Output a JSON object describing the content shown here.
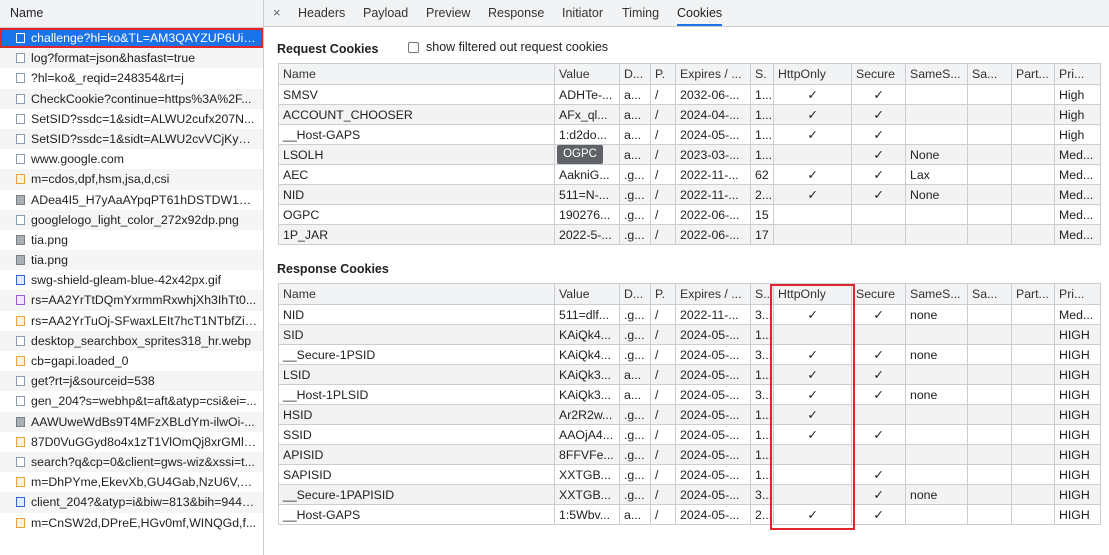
{
  "left_panel": {
    "header": "Name",
    "requests": [
      {
        "name": "challenge?hl=ko&TL=AM3QAYZUP6Ui4...",
        "icon": "document-icon",
        "selected": true
      },
      {
        "name": "log?format=json&hasfast=true",
        "icon": "document-icon"
      },
      {
        "name": "?hl=ko&_reqid=248354&rt=j",
        "icon": "document-icon"
      },
      {
        "name": "CheckCookie?continue=https%3A%2F...",
        "icon": "document-icon"
      },
      {
        "name": "SetSID?ssdc=1&sidt=ALWU2cufx207N...",
        "icon": "document-icon"
      },
      {
        "name": "SetSID?ssdc=1&sidt=ALWU2cvVCjKym...",
        "icon": "document-icon"
      },
      {
        "name": "www.google.com",
        "icon": "document-icon"
      },
      {
        "name": "m=cdos,dpf,hsm,jsa,d,csi",
        "icon": "script-icon"
      },
      {
        "name": "ADea4I5_H7yAaAYpqPT61hDSTDW1AX...",
        "icon": "avatar-image-icon"
      },
      {
        "name": "googlelogo_light_color_272x92dp.png",
        "icon": "document-icon"
      },
      {
        "name": "tia.png",
        "icon": "image-icon"
      },
      {
        "name": "tia.png",
        "icon": "image-icon"
      },
      {
        "name": "swg-shield-gleam-blue-42x42px.gif",
        "icon": "shield-image-icon"
      },
      {
        "name": "rs=AA2YrTtDQmYxrmmRxwhjXh3IhTt0...",
        "icon": "font-icon"
      },
      {
        "name": "rs=AA2YrTuOj-SFwaxLEIt7hcT1NTbfZiP...",
        "icon": "script-icon"
      },
      {
        "name": "desktop_searchbox_sprites318_hr.webp",
        "icon": "document-icon"
      },
      {
        "name": "cb=gapi.loaded_0",
        "icon": "script-icon"
      },
      {
        "name": "get?rt=j&sourceid=538",
        "icon": "document-icon"
      },
      {
        "name": "gen_204?s=webhp&t=aft&atyp=csi&ei=...",
        "icon": "document-icon"
      },
      {
        "name": "AAWUweWdBs9T4MFzXBLdYm-ilwOi-...",
        "icon": "avatar-image-icon"
      },
      {
        "name": "87D0VuGGyd8o4x1zT1VlOmQj8xrGMl1...",
        "icon": "script-icon"
      },
      {
        "name": "search?q&cp=0&client=gws-wiz&xssi=t...",
        "icon": "document-icon"
      },
      {
        "name": "m=DhPYme,EkevXb,GU4Gab,NzU6V,aa...",
        "icon": "script-icon"
      },
      {
        "name": "client_204?&atyp=i&biw=813&bih=944&...",
        "icon": "download-icon"
      },
      {
        "name": "m=CnSW2d,DPreE,HGv0mf,WINQGd,f...",
        "icon": "script-icon"
      }
    ]
  },
  "tabs": {
    "close": "×",
    "items": [
      "Headers",
      "Payload",
      "Preview",
      "Response",
      "Initiator",
      "Timing",
      "Cookies"
    ],
    "active": "Cookies"
  },
  "request_cookies": {
    "title": "Request Cookies",
    "filter_label": "show filtered out request cookies",
    "columns": [
      "Name",
      "Value",
      "D...",
      "P.",
      "Expires / ...",
      "S.",
      "HttpOnly",
      "Secure",
      "SameS...",
      "Sa...",
      "Part...",
      "Pri..."
    ],
    "rows": [
      [
        "SMSV",
        "ADHTe-...",
        "a...",
        "/",
        "2032-06-...",
        "1...",
        "✓",
        "✓",
        "",
        "",
        "",
        "High"
      ],
      [
        "ACCOUNT_CHOOSER",
        "AFx_ql...",
        "a...",
        "/",
        "2024-04-...",
        "1...",
        "✓",
        "✓",
        "",
        "",
        "",
        "High"
      ],
      [
        "__Host-GAPS",
        "1:d2do...",
        "a...",
        "/",
        "2024-05-...",
        "1...",
        "✓",
        "✓",
        "",
        "",
        "",
        "High"
      ],
      [
        "LSOLH",
        "",
        "a...",
        "/",
        "2023-03-...",
        "1...",
        "",
        "✓",
        "None",
        "",
        "",
        "Med..."
      ],
      [
        "AEC",
        "AakniG...",
        ".g...",
        "/",
        "2022-11-...",
        "62",
        "✓",
        "✓",
        "Lax",
        "",
        "",
        "Med..."
      ],
      [
        "NID",
        "511=N-...",
        ".g...",
        "/",
        "2022-11-...",
        "2...",
        "✓",
        "✓",
        "None",
        "",
        "",
        "Med..."
      ],
      [
        "OGPC",
        "190276...",
        ".g...",
        "/",
        "2022-06-...",
        "15",
        "",
        "",
        "",
        "",
        "",
        "Med..."
      ],
      [
        "1P_JAR",
        "2022-5-...",
        ".g...",
        "/",
        "2022-06-...",
        "17",
        "",
        "",
        "",
        "",
        "",
        "Med..."
      ]
    ],
    "tooltip": "OGPC"
  },
  "response_cookies": {
    "title": "Response Cookies",
    "columns": [
      "Name",
      "Value",
      "D...",
      "P.",
      "Expires / ...",
      "S..",
      "HttpOnly",
      "Secure",
      "SameS...",
      "Sa...",
      "Part...",
      "Pri..."
    ],
    "rows": [
      [
        "NID",
        "511=dlf...",
        ".g...",
        "/",
        "2022-11-...",
        "3...",
        "✓",
        "✓",
        "none",
        "",
        "",
        "Med..."
      ],
      [
        "SID",
        "KAiQk4...",
        ".g...",
        "/",
        "2024-05-...",
        "1...",
        "",
        "",
        "",
        "",
        "",
        "HIGH"
      ],
      [
        "__Secure-1PSID",
        "KAiQk4...",
        ".g...",
        "/",
        "2024-05-...",
        "3...",
        "✓",
        "✓",
        "none",
        "",
        "",
        "HIGH"
      ],
      [
        "LSID",
        "KAiQk3...",
        "a...",
        "/",
        "2024-05-...",
        "1...",
        "✓",
        "✓",
        "",
        "",
        "",
        "HIGH"
      ],
      [
        "__Host-1PLSID",
        "KAiQk3...",
        "a...",
        "/",
        "2024-05-...",
        "3...",
        "✓",
        "✓",
        "none",
        "",
        "",
        "HIGH"
      ],
      [
        "HSID",
        "Ar2R2w...",
        ".g...",
        "/",
        "2024-05-...",
        "1...",
        "✓",
        "",
        "",
        "",
        "",
        "HIGH"
      ],
      [
        "SSID",
        "AAOjA4...",
        ".g...",
        "/",
        "2024-05-...",
        "1...",
        "✓",
        "✓",
        "",
        "",
        "",
        "HIGH"
      ],
      [
        "APISID",
        "8FFVFe...",
        ".g...",
        "/",
        "2024-05-...",
        "1...",
        "",
        "",
        "",
        "",
        "",
        "HIGH"
      ],
      [
        "SAPISID",
        "XXTGB...",
        ".g...",
        "/",
        "2024-05-...",
        "1...",
        "",
        "✓",
        "",
        "",
        "",
        "HIGH"
      ],
      [
        "__Secure-1PAPISID",
        "XXTGB...",
        ".g...",
        "/",
        "2024-05-...",
        "3...",
        "",
        "✓",
        "none",
        "",
        "",
        "HIGH"
      ],
      [
        "__Host-GAPS",
        "1:5Wbv...",
        "a...",
        "/",
        "2024-05-...",
        "2...",
        "✓",
        "✓",
        "",
        "",
        "",
        "HIGH"
      ]
    ]
  },
  "colors": {
    "highlight": "#e0262a",
    "selected": "#1a73e8"
  }
}
